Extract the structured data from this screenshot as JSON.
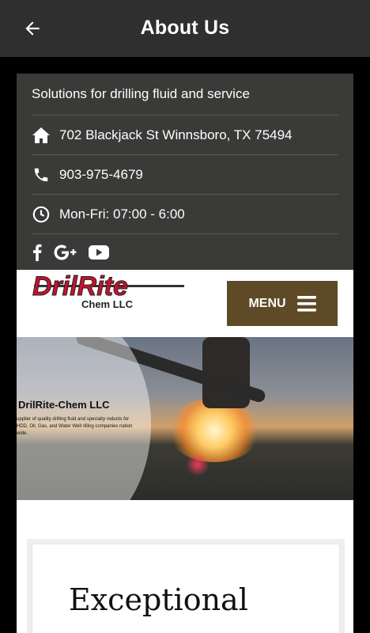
{
  "appbar": {
    "title": "About Us",
    "back_icon": "arrow-left-icon"
  },
  "info": {
    "tagline": "Solutions for drilling fluid and service",
    "address": "702 Blackjack St Winnsboro, TX 75494",
    "phone": "903-975-4679",
    "hours": "Mon-Fri: 07:00 - 6:00",
    "social_icons": [
      "facebook-icon",
      "google-plus-icon",
      "youtube-icon"
    ]
  },
  "site_header": {
    "logo_text": "DrilRite",
    "logo_sub": "Chem LLC",
    "menu_label": "MENU"
  },
  "hero": {
    "title": "DrilRite-Chem LLC",
    "description": "upplier of quality drilling fluid and specialty roducts for HDD, Oil, Gas, and Water Well rilling companies nation wide."
  },
  "content": {
    "heading": "Exceptional"
  },
  "colors": {
    "appbar": "#2f2f2f",
    "info_bg": "#3a3a39",
    "menu_btn": "#5e4a27",
    "logo_red": "#c8102e"
  }
}
